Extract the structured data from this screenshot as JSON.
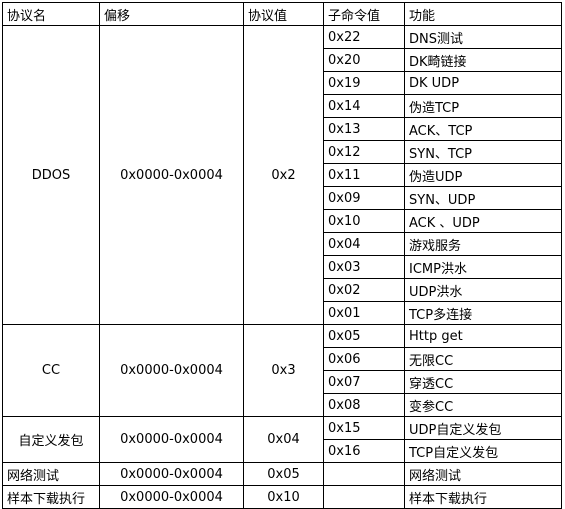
{
  "headers": [
    "协议名",
    "偏移",
    "协议值",
    "子命令值",
    "功能"
  ],
  "groups": [
    {
      "name": "DDOS",
      "offset": "0x0000-0x0004",
      "value": "0x2",
      "subs": [
        [
          "0x22",
          "DNS测试"
        ],
        [
          "0x20",
          "DK畸链接"
        ],
        [
          "0x19",
          "DK UDP"
        ],
        [
          "0x14",
          "伪造TCP"
        ],
        [
          "0x13",
          "ACK、TCP"
        ],
        [
          "0x12",
          "SYN、TCP"
        ],
        [
          "0x11",
          "伪造UDP"
        ],
        [
          "0x09",
          "SYN、UDP"
        ],
        [
          "0x10",
          "ACK 、UDP"
        ],
        [
          "0x04",
          "游戏服务"
        ],
        [
          "0x03",
          "ICMP洪水"
        ],
        [
          "0x02",
          "UDP洪水"
        ],
        [
          "0x01",
          "TCP多连接"
        ]
      ]
    },
    {
      "name": "CC",
      "offset": "0x0000-0x0004",
      "value": "0x3",
      "subs": [
        [
          "0x05",
          "Http get"
        ],
        [
          "0x06",
          "无限CC"
        ],
        [
          "0x07",
          "穿透CC"
        ],
        [
          "0x08",
          "变参CC"
        ]
      ]
    },
    {
      "name": "自定义发包",
      "offset": "0x0000-0x0004",
      "value": "0x04",
      "subs": [
        [
          "0x15",
          "UDP自定义发包"
        ],
        [
          "0x16",
          "TCP自定义发包"
        ]
      ]
    }
  ],
  "extra_rows": [
    {
      "name": "网络测试",
      "offset": "0x0000-0x0004",
      "value": "0x05",
      "sub": "",
      "func": "网络测试"
    },
    {
      "name": "样本下载执行",
      "offset": "0x0000-0x0004",
      "value": "0x10",
      "sub": "",
      "func": "样本下载执行"
    }
  ]
}
